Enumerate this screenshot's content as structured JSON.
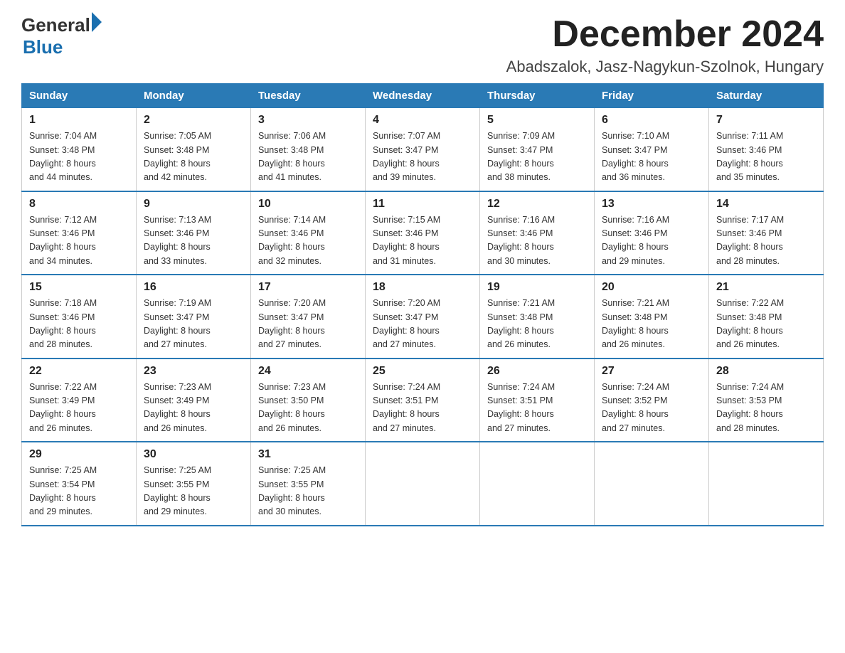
{
  "logo": {
    "text_general": "General",
    "text_blue": "Blue"
  },
  "header": {
    "month": "December 2024",
    "location": "Abadszalok, Jasz-Nagykun-Szolnok, Hungary"
  },
  "weekdays": [
    "Sunday",
    "Monday",
    "Tuesday",
    "Wednesday",
    "Thursday",
    "Friday",
    "Saturday"
  ],
  "weeks": [
    [
      {
        "day": "1",
        "sunrise": "7:04 AM",
        "sunset": "3:48 PM",
        "daylight": "8 hours and 44 minutes."
      },
      {
        "day": "2",
        "sunrise": "7:05 AM",
        "sunset": "3:48 PM",
        "daylight": "8 hours and 42 minutes."
      },
      {
        "day": "3",
        "sunrise": "7:06 AM",
        "sunset": "3:48 PM",
        "daylight": "8 hours and 41 minutes."
      },
      {
        "day": "4",
        "sunrise": "7:07 AM",
        "sunset": "3:47 PM",
        "daylight": "8 hours and 39 minutes."
      },
      {
        "day": "5",
        "sunrise": "7:09 AM",
        "sunset": "3:47 PM",
        "daylight": "8 hours and 38 minutes."
      },
      {
        "day": "6",
        "sunrise": "7:10 AM",
        "sunset": "3:47 PM",
        "daylight": "8 hours and 36 minutes."
      },
      {
        "day": "7",
        "sunrise": "7:11 AM",
        "sunset": "3:46 PM",
        "daylight": "8 hours and 35 minutes."
      }
    ],
    [
      {
        "day": "8",
        "sunrise": "7:12 AM",
        "sunset": "3:46 PM",
        "daylight": "8 hours and 34 minutes."
      },
      {
        "day": "9",
        "sunrise": "7:13 AM",
        "sunset": "3:46 PM",
        "daylight": "8 hours and 33 minutes."
      },
      {
        "day": "10",
        "sunrise": "7:14 AM",
        "sunset": "3:46 PM",
        "daylight": "8 hours and 32 minutes."
      },
      {
        "day": "11",
        "sunrise": "7:15 AM",
        "sunset": "3:46 PM",
        "daylight": "8 hours and 31 minutes."
      },
      {
        "day": "12",
        "sunrise": "7:16 AM",
        "sunset": "3:46 PM",
        "daylight": "8 hours and 30 minutes."
      },
      {
        "day": "13",
        "sunrise": "7:16 AM",
        "sunset": "3:46 PM",
        "daylight": "8 hours and 29 minutes."
      },
      {
        "day": "14",
        "sunrise": "7:17 AM",
        "sunset": "3:46 PM",
        "daylight": "8 hours and 28 minutes."
      }
    ],
    [
      {
        "day": "15",
        "sunrise": "7:18 AM",
        "sunset": "3:46 PM",
        "daylight": "8 hours and 28 minutes."
      },
      {
        "day": "16",
        "sunrise": "7:19 AM",
        "sunset": "3:47 PM",
        "daylight": "8 hours and 27 minutes."
      },
      {
        "day": "17",
        "sunrise": "7:20 AM",
        "sunset": "3:47 PM",
        "daylight": "8 hours and 27 minutes."
      },
      {
        "day": "18",
        "sunrise": "7:20 AM",
        "sunset": "3:47 PM",
        "daylight": "8 hours and 27 minutes."
      },
      {
        "day": "19",
        "sunrise": "7:21 AM",
        "sunset": "3:48 PM",
        "daylight": "8 hours and 26 minutes."
      },
      {
        "day": "20",
        "sunrise": "7:21 AM",
        "sunset": "3:48 PM",
        "daylight": "8 hours and 26 minutes."
      },
      {
        "day": "21",
        "sunrise": "7:22 AM",
        "sunset": "3:48 PM",
        "daylight": "8 hours and 26 minutes."
      }
    ],
    [
      {
        "day": "22",
        "sunrise": "7:22 AM",
        "sunset": "3:49 PM",
        "daylight": "8 hours and 26 minutes."
      },
      {
        "day": "23",
        "sunrise": "7:23 AM",
        "sunset": "3:49 PM",
        "daylight": "8 hours and 26 minutes."
      },
      {
        "day": "24",
        "sunrise": "7:23 AM",
        "sunset": "3:50 PM",
        "daylight": "8 hours and 26 minutes."
      },
      {
        "day": "25",
        "sunrise": "7:24 AM",
        "sunset": "3:51 PM",
        "daylight": "8 hours and 27 minutes."
      },
      {
        "day": "26",
        "sunrise": "7:24 AM",
        "sunset": "3:51 PM",
        "daylight": "8 hours and 27 minutes."
      },
      {
        "day": "27",
        "sunrise": "7:24 AM",
        "sunset": "3:52 PM",
        "daylight": "8 hours and 27 minutes."
      },
      {
        "day": "28",
        "sunrise": "7:24 AM",
        "sunset": "3:53 PM",
        "daylight": "8 hours and 28 minutes."
      }
    ],
    [
      {
        "day": "29",
        "sunrise": "7:25 AM",
        "sunset": "3:54 PM",
        "daylight": "8 hours and 29 minutes."
      },
      {
        "day": "30",
        "sunrise": "7:25 AM",
        "sunset": "3:55 PM",
        "daylight": "8 hours and 29 minutes."
      },
      {
        "day": "31",
        "sunrise": "7:25 AM",
        "sunset": "3:55 PM",
        "daylight": "8 hours and 30 minutes."
      },
      null,
      null,
      null,
      null
    ]
  ]
}
